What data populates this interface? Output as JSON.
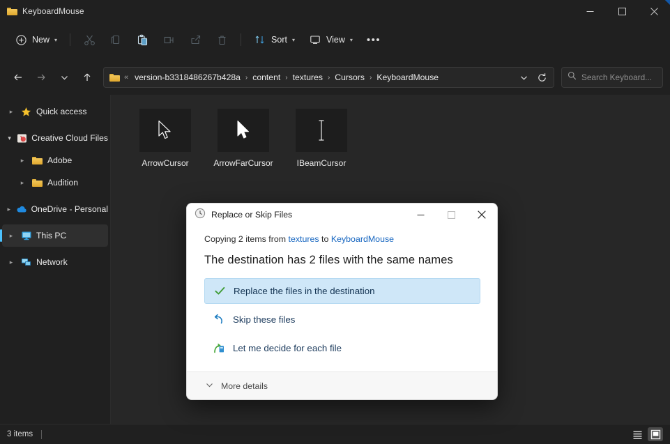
{
  "window": {
    "title": "KeyboardMouse",
    "folder_icon": "folder-icon",
    "minimize": "minimize-icon",
    "maximize": "maximize-icon",
    "close": "close-icon"
  },
  "toolbar": {
    "new_label": "New",
    "new_icon": "plus-circle-icon",
    "cut_icon": "scissors-icon",
    "copy_icon": "copy-icon",
    "paste_icon": "paste-icon",
    "rename_icon": "rename-icon",
    "share_icon": "share-icon",
    "delete_icon": "trash-icon",
    "sort_label": "Sort",
    "sort_icon": "sort-arrows-icon",
    "view_label": "View",
    "view_icon": "monitor-icon",
    "more_label": "•••"
  },
  "navigation": {
    "back_icon": "arrow-left-icon",
    "forward_icon": "arrow-right-icon",
    "recent_icon": "chevron-down-icon",
    "up_icon": "arrow-up-icon",
    "breadcrumb_overflow": "«",
    "breadcrumbs": [
      "version-b3318486267b428a",
      "content",
      "textures",
      "Cursors",
      "KeyboardMouse"
    ],
    "separator": "›",
    "dropdown_icon": "chevron-down-icon",
    "refresh_icon": "refresh-icon"
  },
  "search": {
    "placeholder": "Search Keyboard...",
    "icon": "search-icon"
  },
  "sidebar": {
    "items": [
      {
        "label": "Quick access",
        "icon": "star-icon",
        "arrow": "collapsed",
        "indent": false,
        "selected": false
      },
      {
        "label": "Creative Cloud Files",
        "icon": "creative-cloud-icon",
        "arrow": "expanded",
        "indent": false,
        "selected": false
      },
      {
        "label": "Adobe",
        "icon": "folder-icon",
        "arrow": "collapsed",
        "indent": true,
        "selected": false
      },
      {
        "label": "Audition",
        "icon": "folder-icon",
        "arrow": "collapsed",
        "indent": true,
        "selected": false
      },
      {
        "label": "OneDrive - Personal",
        "icon": "onedrive-cloud-icon",
        "arrow": "collapsed",
        "indent": false,
        "selected": false
      },
      {
        "label": "This PC",
        "icon": "monitor-icon",
        "arrow": "collapsed",
        "indent": false,
        "selected": true
      },
      {
        "label": "Network",
        "icon": "network-icon",
        "arrow": "collapsed",
        "indent": false,
        "selected": false
      }
    ]
  },
  "content": {
    "files": [
      {
        "name": "ArrowCursor",
        "icon": "arrow-cursor-outline-icon"
      },
      {
        "name": "ArrowFarCursor",
        "icon": "arrow-cursor-filled-icon"
      },
      {
        "name": "IBeamCursor",
        "icon": "ibeam-cursor-icon"
      }
    ]
  },
  "statusbar": {
    "item_count": "3 items",
    "list_view_icon": "list-view-icon",
    "tiles_view_icon": "large-icons-view-icon"
  },
  "dialog": {
    "title": "Replace or Skip Files",
    "title_icon": "clock-history-icon",
    "minimize": "minimize-icon",
    "maximize": "maximize-icon",
    "close": "close-icon",
    "subtitle_prefix": "Copying 2 items from ",
    "subtitle_source": "textures",
    "subtitle_middle": " to ",
    "subtitle_dest": "KeyboardMouse",
    "heading": "The destination has 2 files with the same names",
    "options": [
      {
        "label": "Replace the files in the destination",
        "icon": "green-check-icon",
        "selected": true
      },
      {
        "label": "Skip these files",
        "icon": "blue-skip-arrow-icon",
        "selected": false
      },
      {
        "label": "Let me decide for each file",
        "icon": "green-arrow-blue-file-icon",
        "selected": false
      }
    ],
    "more_details_label": "More details",
    "more_details_icon": "chevron-down-icon"
  },
  "colors": {
    "window_bg": "#202020",
    "content_bg": "#272727",
    "accent_blue": "#4cc2ff",
    "link_blue": "#1565c0",
    "selection_blue": "#cfe7f8",
    "check_green": "#3f9c35"
  }
}
